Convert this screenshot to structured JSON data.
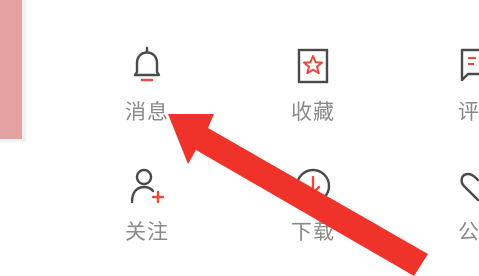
{
  "colors": {
    "accent": "#e74c3c",
    "icon_gray": "#4a4a4a",
    "label_gray": "#8a8a8a",
    "annotation_arrow": "#f0332a"
  },
  "menu": {
    "items": [
      {
        "label": "消息",
        "icon": "bell-icon"
      },
      {
        "label": "收藏",
        "icon": "star-bookmark-icon"
      },
      {
        "label": "评",
        "icon": "comment-icon"
      },
      {
        "label": "关注",
        "icon": "add-user-icon"
      },
      {
        "label": "下载",
        "icon": "download-icon"
      },
      {
        "label": "公",
        "icon": "heart-icon"
      }
    ]
  }
}
